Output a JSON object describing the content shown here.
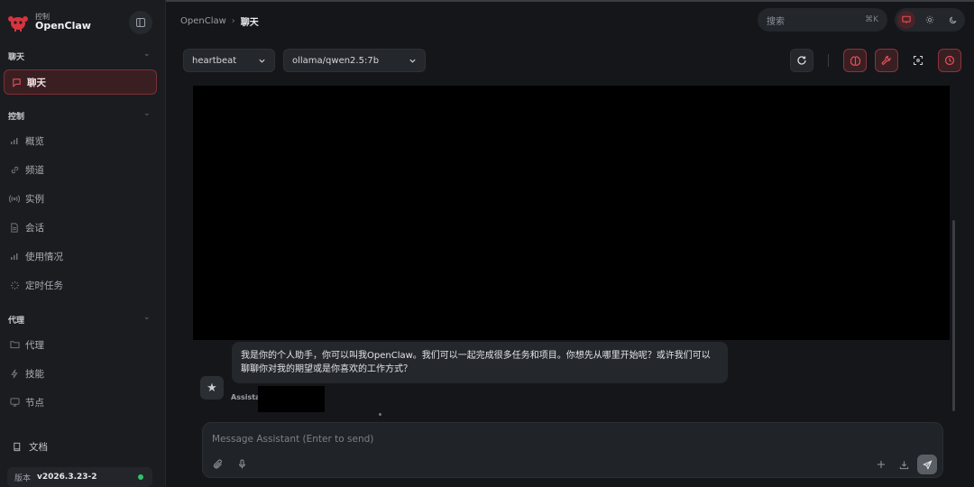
{
  "app": {
    "brand_sub": "控制",
    "brand_title": "OpenClaw",
    "accent_color": "#e3525b"
  },
  "sidebar": {
    "sections": [
      {
        "title": "聊天",
        "items": [
          {
            "label": "聊天",
            "icon": "message-square-icon",
            "active": true
          }
        ]
      },
      {
        "title": "控制",
        "items": [
          {
            "label": "概览",
            "icon": "bar-chart-icon"
          },
          {
            "label": "频道",
            "icon": "link-icon"
          },
          {
            "label": "实例",
            "icon": "broadcast-icon"
          },
          {
            "label": "会话",
            "icon": "file-text-icon"
          },
          {
            "label": "使用情况",
            "icon": "bar-chart-icon"
          },
          {
            "label": "定时任务",
            "icon": "loader-icon"
          }
        ]
      },
      {
        "title": "代理",
        "items": [
          {
            "label": "代理",
            "icon": "folder-icon"
          },
          {
            "label": "技能",
            "icon": "zap-icon"
          },
          {
            "label": "节点",
            "icon": "monitor-icon"
          }
        ]
      }
    ],
    "docs_label": "文档",
    "version_label": "版本",
    "version_value": "v2026.3.23-2",
    "status_color": "#2fc26b"
  },
  "header": {
    "breadcrumb_root": "OpenClaw",
    "breadcrumb_sep": "›",
    "breadcrumb_current": "聊天",
    "search_placeholder": "搜索",
    "search_shortcut": "⌘K"
  },
  "toolbar": {
    "session_value": "heartbeat",
    "model_value": "ollama/qwen2.5:7b"
  },
  "chat": {
    "messages": [
      {
        "sender": "Assistant",
        "text": "我是你的个人助手，你可以叫我OpenClaw。我们可以一起完成很多任务和项目。你想先从哪里开始呢？或许我们可以聊聊你对我的期望或是你喜欢的工作方式？"
      }
    ]
  },
  "composer": {
    "placeholder": "Message Assistant (Enter to send)"
  }
}
